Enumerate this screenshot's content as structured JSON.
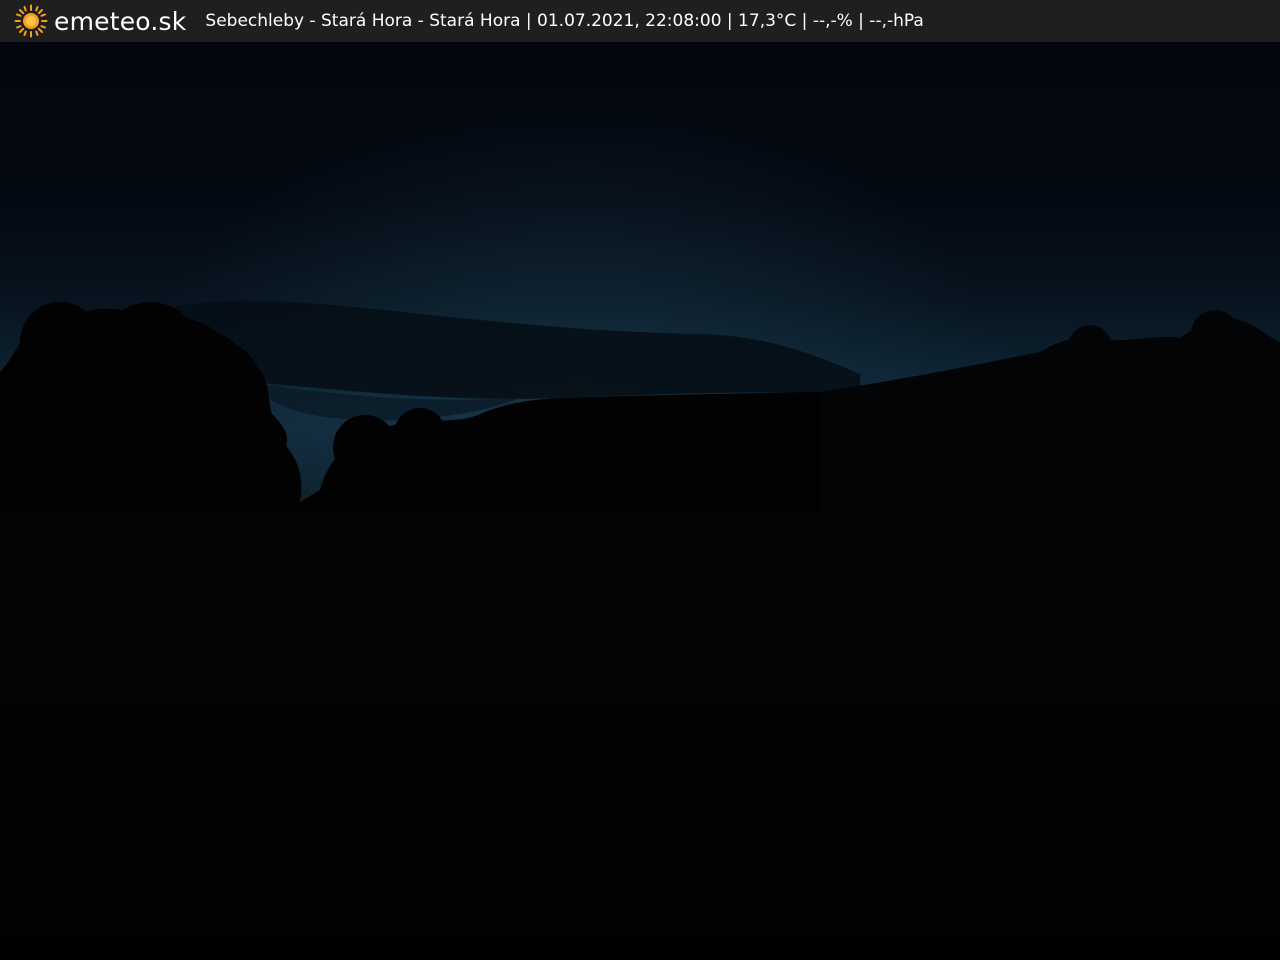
{
  "header": {
    "logo_icon": "sun-icon",
    "brand": "emeteo.sk",
    "caption": "Sebechleby - Stará Hora - Stará Hora | 01.07.2021, 22:08:00 | 17,3°C | --,-% | --,-hPa"
  },
  "colors": {
    "header_bg": "#1f1f1f",
    "logo_sun": "#f4a21c",
    "sky_top": "#03060d",
    "sky_horizon": "#0f2a3a",
    "ground": "#020202"
  }
}
